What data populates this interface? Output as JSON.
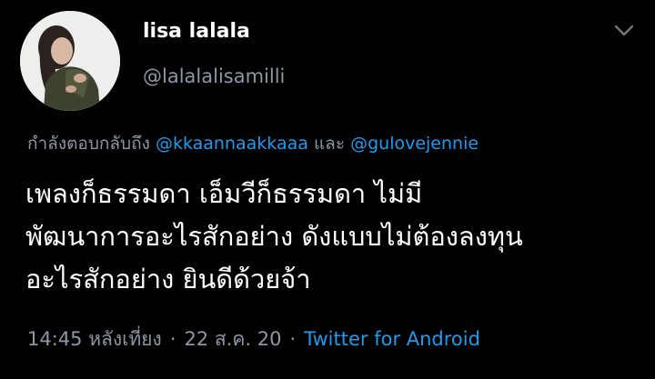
{
  "author": {
    "display_name": "lisa lalala",
    "handle": "@lalalalisamilli",
    "avatar_icon": "profile-photo"
  },
  "menu": {
    "icon": "chevron-down-icon"
  },
  "reply": {
    "prefix": "กำลังตอบกลับถึง",
    "mention_1": "@kkaannaakkaaa",
    "conjunction": "และ",
    "mention_2": "@gulovejennie"
  },
  "tweet": {
    "lines": [
      "เพลงก็ธรรมดา เอ็มวีก็ธรรมดา ไม่มี",
      "พัฒนาการอะไรสักอย่าง ดังแบบไม่ต้องลงทุน",
      "อะไรสักอย่าง ยินดีด้วยจ้า"
    ]
  },
  "meta": {
    "time": "14:45 หลังเที่ยง",
    "separator": "·",
    "date": "22 ส.ค. 20",
    "source": "Twitter for Android"
  },
  "colors": {
    "background": "#000000",
    "primary_text": "#ffffff",
    "secondary_text": "#8b98a5",
    "link": "#1d9bf0"
  }
}
